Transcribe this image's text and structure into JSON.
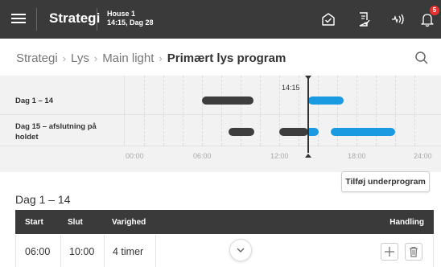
{
  "header": {
    "title": "Strategi",
    "house_name": "House 1",
    "house_time": "14:15, Dag 28",
    "notification_count": "5"
  },
  "breadcrumb": {
    "items": [
      "Strategi",
      "Lys",
      "Main light"
    ],
    "current": "Primært lys program"
  },
  "timeline": {
    "now_label": "14:15",
    "ticks": [
      "00:00",
      "06:00",
      "12:00",
      "18:00",
      "24:00"
    ],
    "rows": [
      {
        "label": "Dag 1 – 14",
        "bars": [
          {
            "start": "06:00",
            "end": "10:00",
            "state": "past"
          },
          {
            "start": "14:15",
            "end": "17:00",
            "state": "future"
          }
        ]
      },
      {
        "label": "Dag 15 – afslutning på holdet",
        "bars": [
          {
            "start": "08:00",
            "end": "10:00",
            "state": "past"
          },
          {
            "start": "12:00",
            "end": "14:15",
            "state": "past"
          },
          {
            "start": "14:15",
            "end": "15:00",
            "state": "future"
          },
          {
            "start": "16:00",
            "end": "21:00",
            "state": "future"
          }
        ]
      }
    ]
  },
  "add_subprogram_label": "Tilføj underprogram",
  "section": {
    "title": "Dag 1 – 14",
    "columns": {
      "start": "Start",
      "end": "Slut",
      "duration": "Varighed",
      "action": "Handling"
    },
    "rows": [
      {
        "start": "06:00",
        "end": "10:00",
        "duration": "4 timer"
      }
    ]
  },
  "colors": {
    "topbar": "#3a3a3a",
    "past_bar": "#3d3d3d",
    "future_bar": "#1a9ae0",
    "badge": "#e8312f"
  },
  "icons": [
    "menu-icon",
    "check-home-icon",
    "document-edit-icon",
    "signal-icon",
    "bell-icon",
    "search-icon",
    "chevron-down-icon",
    "plus-icon",
    "trash-icon"
  ]
}
